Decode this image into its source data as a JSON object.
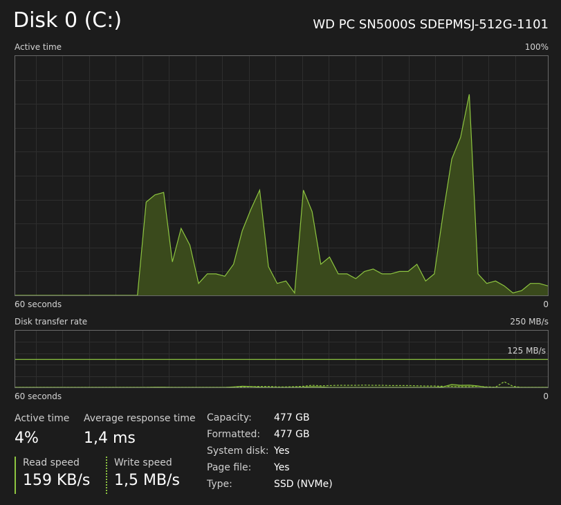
{
  "header": {
    "title": "Disk 0 (C:)",
    "model": "WD PC SN5000S SDEPMSJ-512G-1101"
  },
  "active_graph": {
    "label": "Active time",
    "max_label": "100%",
    "time_label": "60 seconds",
    "min_label": "0",
    "values": [
      0,
      0,
      0,
      0,
      0,
      0,
      0,
      0,
      0,
      0,
      0,
      0,
      0,
      0,
      0,
      39,
      42,
      43,
      14,
      28,
      21,
      5,
      9,
      9,
      8,
      13,
      27,
      36,
      44,
      12,
      5,
      6,
      1,
      44,
      35,
      13,
      16,
      9,
      9,
      7,
      10,
      11,
      9,
      9,
      10,
      10,
      13,
      6,
      9,
      34,
      57,
      66,
      84,
      9,
      5,
      6,
      4,
      1,
      2,
      5,
      5,
      4
    ]
  },
  "transfer_graph": {
    "label": "Disk transfer rate",
    "max_label": "250 MB/s",
    "mid_label": "125 MB/s",
    "time_label": "60 seconds",
    "min_label": "0",
    "read_values": [
      0,
      0,
      0,
      0,
      0,
      0,
      0,
      0,
      0,
      0,
      0,
      0,
      0,
      0,
      0,
      0,
      1,
      1,
      0,
      0,
      0,
      0,
      0,
      0,
      0,
      2,
      5,
      4,
      1,
      0,
      0,
      0,
      0,
      1,
      3,
      2,
      0,
      0,
      0,
      0,
      0,
      0,
      0,
      0,
      0,
      0,
      0,
      0,
      0,
      2,
      13,
      9,
      10,
      6,
      0,
      0,
      0,
      0,
      0,
      0,
      0,
      0
    ],
    "write_values": [
      0,
      0,
      0,
      0,
      0,
      0,
      0,
      0,
      0,
      0,
      0,
      0,
      0,
      0,
      0,
      0,
      0,
      0,
      0,
      0,
      0,
      0,
      0,
      0,
      0,
      0,
      2,
      3,
      4,
      4,
      2,
      2,
      3,
      5,
      9,
      7,
      8,
      9,
      9,
      9,
      10,
      9,
      9,
      8,
      8,
      8,
      7,
      6,
      6,
      5,
      4,
      3,
      3,
      5,
      2,
      1,
      25,
      5,
      0,
      0,
      0,
      0
    ]
  },
  "stats": {
    "active_time_label": "Active time",
    "active_time_value": "4%",
    "avg_response_label": "Average response time",
    "avg_response_value": "1,4 ms",
    "read_label": "Read speed",
    "read_value": "159 KB/s",
    "write_label": "Write speed",
    "write_value": "1,5 MB/s"
  },
  "properties": [
    {
      "key": "Capacity:",
      "value": "477 GB"
    },
    {
      "key": "Formatted:",
      "value": "477 GB"
    },
    {
      "key": "System disk:",
      "value": "Yes"
    },
    {
      "key": "Page file:",
      "value": "Yes"
    },
    {
      "key": "Type:",
      "value": "SSD (NVMe)"
    }
  ],
  "colors": {
    "accent": "#8ec640",
    "fill": "#3a4a1c",
    "grid": "#2e2e2e",
    "border": "#6a6a6a"
  }
}
